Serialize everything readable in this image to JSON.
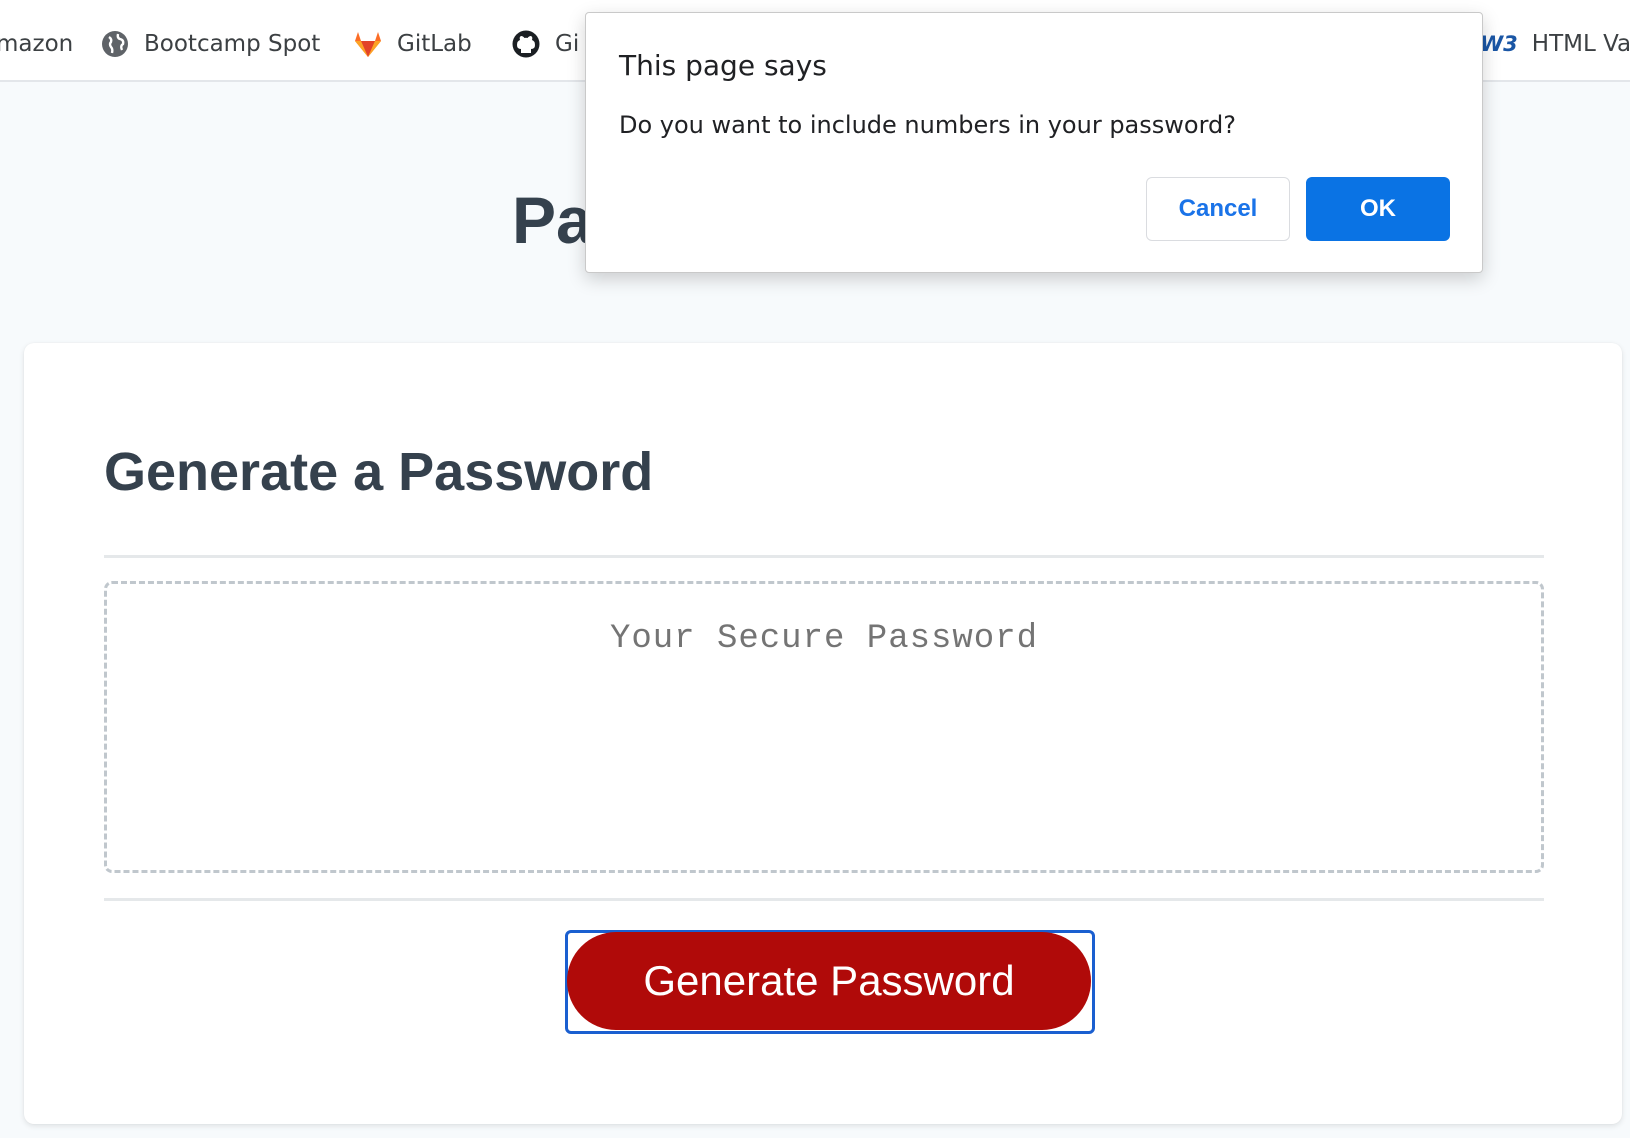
{
  "bookmarks": {
    "items": [
      {
        "label": "mazon",
        "icon": "none"
      },
      {
        "label": "Bootcamp Spot",
        "icon": "globe-icon"
      },
      {
        "label": "GitLab",
        "icon": "gitlab-icon"
      },
      {
        "label": "Gi",
        "icon": "github-icon"
      },
      {
        "label": "HTML Val",
        "icon": "w3c-icon",
        "icon_text": "W3"
      }
    ]
  },
  "page": {
    "heading_visible_text": "Pa"
  },
  "card": {
    "title": "Generate a Password",
    "password_placeholder": "Your Secure Password",
    "password_value": "",
    "generate_button_label": "Generate Password"
  },
  "dialog": {
    "title": "This page says",
    "message": "Do you want to include numbers in your password?",
    "cancel_label": "Cancel",
    "ok_label": "OK"
  },
  "colors": {
    "page_bg": "#f7fafc",
    "heading_text": "#35414d",
    "generate_button_bg": "#b00a09",
    "ok_button_bg": "#0a73e4",
    "cancel_text": "#1a73e8",
    "focus_ring": "#1a5fd0"
  }
}
